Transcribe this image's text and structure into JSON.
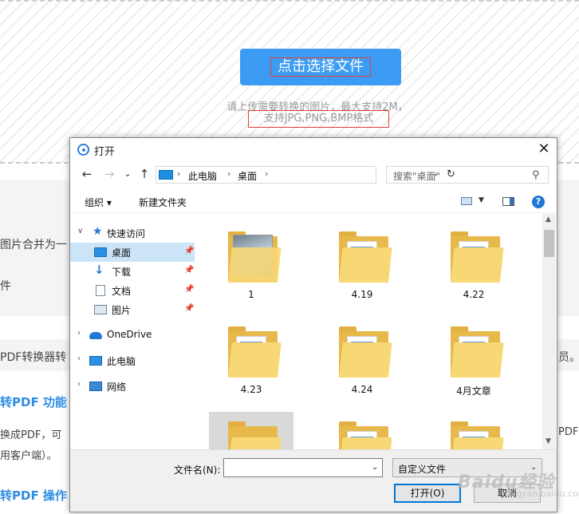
{
  "background": {
    "select_button": "点击选择文件",
    "hint_line1": "请上传需要转换的图片，最大支持2M，",
    "hint_line2": "支持JPG,PNG,BMP格式",
    "fragments": {
      "f1": "图片合并为一",
      "f2": "件",
      "f3": "PDF转换器转",
      "f4": "员。",
      "f5": "转PDF 功能",
      "f6": "换成PDF，可",
      "f7": "PDF",
      "f8": "用客户端）。",
      "f9": "转PDF 操作"
    }
  },
  "dialog": {
    "title": "打开",
    "close": "✕",
    "nav": {
      "back": "←",
      "forward": "→",
      "dropdown": "⌄",
      "up": "↑"
    },
    "breadcrumb": [
      "此电脑",
      "桌面"
    ],
    "breadcrumb_sep": "›",
    "refresh": "↻",
    "search_placeholder": "搜索\"桌面\"",
    "toolbar": {
      "organize": "组织 ▾",
      "new_folder": "新建文件夹"
    },
    "help": "?",
    "nav_pane": {
      "quick_access": "快速访问",
      "desktop": "桌面",
      "downloads": "下载",
      "documents": "文档",
      "pictures": "图片",
      "onedrive": "OneDrive",
      "this_pc": "此电脑",
      "network": "网络"
    },
    "folders": [
      {
        "name": "1",
        "kind": "photo"
      },
      {
        "name": "4.19",
        "kind": "folder"
      },
      {
        "name": "4.22",
        "kind": "folder"
      },
      {
        "name": "4.23",
        "kind": "folder"
      },
      {
        "name": "4.24",
        "kind": "folder"
      },
      {
        "name": "4月文章",
        "kind": "folder"
      }
    ],
    "filename_label": "文件名(N):",
    "filename_value": "",
    "filetype": "自定义文件",
    "open_button": "打开(O)",
    "cancel_button": "取消"
  },
  "watermark": {
    "text": "Baidu经验",
    "sub": "jingyan.baidu.com"
  }
}
